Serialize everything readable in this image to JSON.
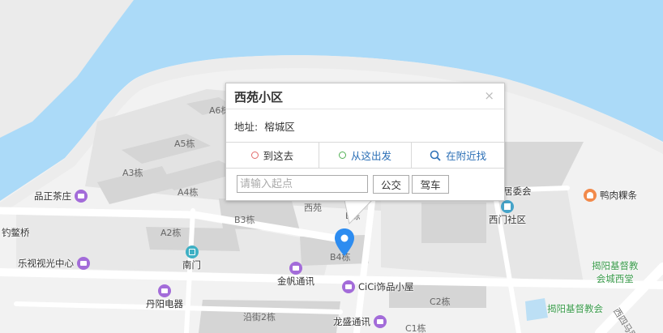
{
  "popup": {
    "title": "西苑小区",
    "close": "×",
    "address_label": "地址:",
    "address_value": "榕城区",
    "tabs": [
      "到这去",
      "从这出发",
      "在附近找"
    ],
    "input_placeholder": "请输入起点",
    "input_value": "",
    "btn_bus": "公交",
    "btn_drive": "驾车"
  },
  "buildings": {
    "a6": "A6栋",
    "a5": "A5栋",
    "a3": "A3栋",
    "a4": "A4栋",
    "a2": "A2栋",
    "b3": "B3栋",
    "b4": "B4栋",
    "b_a": "西苑",
    "b_short": "B栋",
    "c2": "C2栋",
    "c1": "C1栋",
    "yanzhi2": "沿街2栋"
  },
  "pois": {
    "pinzheng": "品正茶庄",
    "diaoying": "钓鳖桥",
    "leshi": "乐视视光中心",
    "nanmen": "南门",
    "jinfan": "金帆通讯",
    "danyang": "丹阳电器",
    "cici": "CiCi饰品小屋",
    "longsheng": "龙盛通讯",
    "weiyuanhui": "居委会",
    "ximen": "西门社区",
    "yarou": "鸭肉粿条",
    "church1": "揭阳基督教会城西堂",
    "church1_l1": "揭阳基督教",
    "church1_l2": "会城西堂",
    "church2": "揭阳基督教会",
    "road": "西四马路"
  },
  "colors": {
    "water": "#abdaf8",
    "land": "#f2f2f2",
    "block": "#e3e3e3",
    "building": "#d5d5d5",
    "marker": "#2d8cf0",
    "link": "#2b6fb6",
    "poi_shop": "#a36cd9"
  }
}
